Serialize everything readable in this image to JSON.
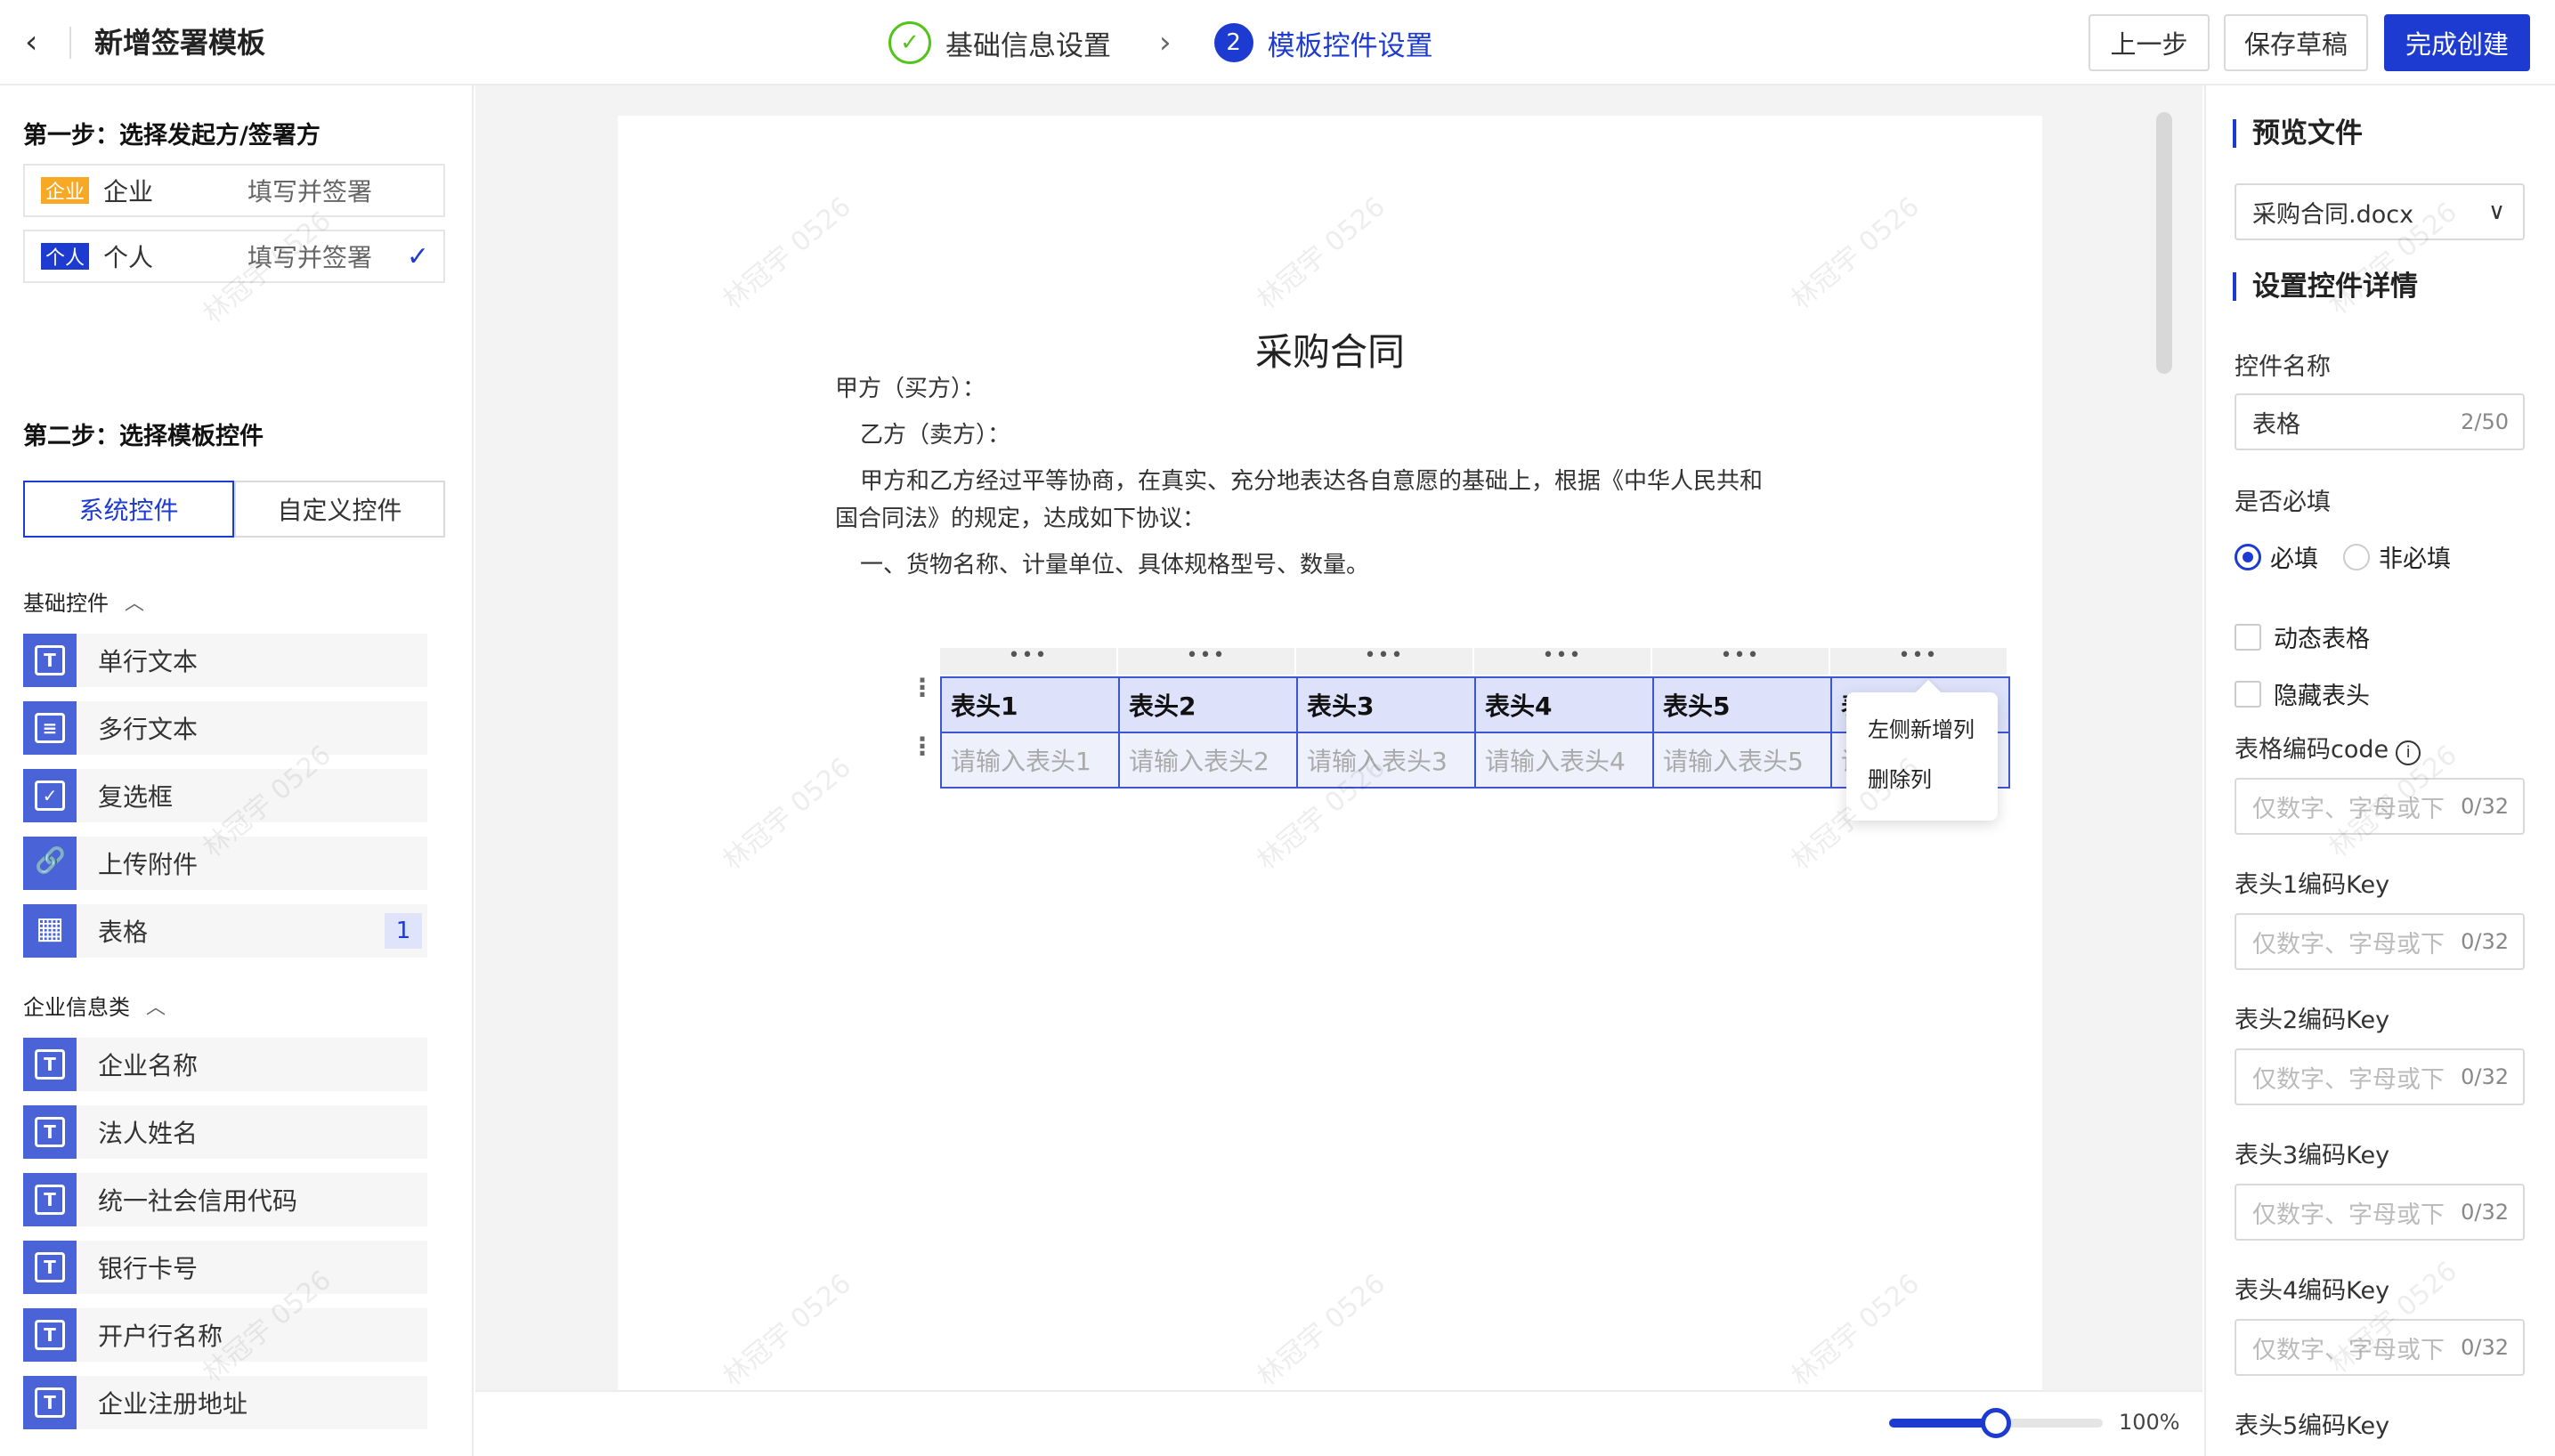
{
  "header": {
    "back_icon": "chevron-left-icon",
    "title": "新增签署模板",
    "steps": [
      {
        "label": "基础信息设置",
        "status": "done"
      },
      {
        "label": "模板控件设置",
        "status": "current",
        "index": "2"
      }
    ],
    "buttons": {
      "prev": "上一步",
      "draft": "保存草稿",
      "finish": "完成创建"
    }
  },
  "left": {
    "step1_title": "第一步：选择发起方/签署方",
    "parties": [
      {
        "tag": "企业",
        "name": "企业",
        "action": "填写并签署",
        "selected": false
      },
      {
        "tag": "个人",
        "name": "个人",
        "action": "填写并签署",
        "selected": true
      }
    ],
    "step2_title": "第二步：选择模板控件",
    "tabs": [
      "系统控件",
      "自定义控件"
    ],
    "groups": [
      {
        "title": "基础控件",
        "items": [
          {
            "label": "单行文本",
            "icon": "T"
          },
          {
            "label": "多行文本",
            "icon": "≡"
          },
          {
            "label": "复选框",
            "icon": "✓"
          },
          {
            "label": "上传附件",
            "icon": "🔗"
          },
          {
            "label": "表格",
            "icon": "▦",
            "badge": "1"
          }
        ]
      },
      {
        "title": "企业信息类",
        "items": [
          {
            "label": "企业名称",
            "icon": "T"
          },
          {
            "label": "法人姓名",
            "icon": "T"
          },
          {
            "label": "统一社会信用代码",
            "icon": "T"
          },
          {
            "label": "银行卡号",
            "icon": "T"
          },
          {
            "label": "开户行名称",
            "icon": "T"
          },
          {
            "label": "企业注册地址",
            "icon": "T"
          }
        ]
      }
    ]
  },
  "document": {
    "title": "采购合同",
    "lines": [
      "甲方（买方）：",
      "乙方（卖方）：",
      "甲方和乙方经过平等协商，在真实、充分地表达各自意愿的基础上，根据《中华人民共和",
      "国合同法》的规定，达成如下协议：",
      "一、货物名称、计量单位、具体规格型号、数量。"
    ],
    "table": {
      "col_handle": "•••",
      "row_handle": "⋮",
      "headers": [
        "表头1",
        "表头2",
        "表头3",
        "表头4",
        "表头5",
        "表"
      ],
      "placeholders": [
        "请输入表头1",
        "请输入表头2",
        "请输入表头3",
        "请输入表头4",
        "请输入表头5",
        "请"
      ]
    },
    "context_menu": [
      "左侧新增列",
      "删除列"
    ],
    "watermark": "林冠宇 0526"
  },
  "zoom": {
    "value": 0.5,
    "label": "100%"
  },
  "right": {
    "preview_title": "预览文件",
    "file_select": "采购合同.docx",
    "detail_title": "设置控件详情",
    "name_label": "控件名称",
    "name_value": "表格",
    "name_count": "2/50",
    "required_label": "是否必填",
    "required_options": [
      "必填",
      "非必填"
    ],
    "dynamic_table": "动态表格",
    "hide_header": "隐藏表头",
    "code_label": "表格编码code",
    "code_placeholder": "仅数字、字母或下",
    "code_count": "0/32",
    "key_fields": [
      {
        "label": "表头1编码Key",
        "placeholder": "仅数字、字母或下",
        "count": "0/32"
      },
      {
        "label": "表头2编码Key",
        "placeholder": "仅数字、字母或下",
        "count": "0/32"
      },
      {
        "label": "表头3编码Key",
        "placeholder": "仅数字、字母或下",
        "count": "0/32"
      },
      {
        "label": "表头4编码Key",
        "placeholder": "仅数字、字母或下",
        "count": "0/32"
      },
      {
        "label": "表头5编码Key"
      }
    ]
  },
  "colors": {
    "primary": "#1d3bd1",
    "success": "#52c41a",
    "tag_orange": "#f7a825"
  }
}
